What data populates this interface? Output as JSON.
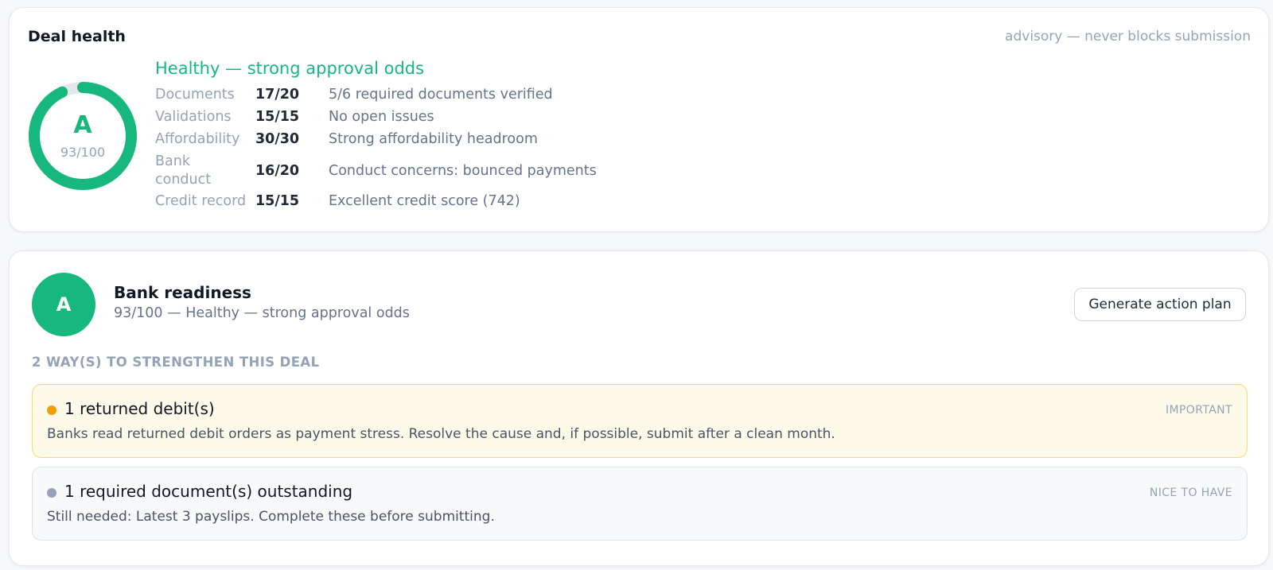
{
  "deal_health": {
    "title": "Deal health",
    "note": "advisory — never blocks submission",
    "grade": "A",
    "score_text": "93/100",
    "score": 93,
    "score_max": 100,
    "status": "Healthy — strong approval odds",
    "factors": [
      {
        "name": "Documents",
        "score": "17/20",
        "note": "5/6 required documents verified"
      },
      {
        "name": "Validations",
        "score": "15/15",
        "note": "No open issues"
      },
      {
        "name": "Affordability",
        "score": "30/30",
        "note": "Strong affordability headroom"
      },
      {
        "name": "Bank conduct",
        "score": "16/20",
        "note": "Conduct concerns: bounced payments"
      },
      {
        "name": "Credit record",
        "score": "15/15",
        "note": "Excellent credit score (742)"
      }
    ]
  },
  "bank_readiness": {
    "grade": "A",
    "title": "Bank readiness",
    "subtitle": "93/100 — Healthy — strong approval odds",
    "action_button": "Generate action plan",
    "ways_heading": "2 WAY(S) TO STRENGTHEN THIS DEAL",
    "recommendations": [
      {
        "title": "1 returned debit(s)",
        "badge": "IMPORTANT",
        "body": "Banks read returned debit orders as payment stress. Resolve the cause and, if possible, submit after a clean month."
      },
      {
        "title": "1 required document(s) outstanding",
        "badge": "NICE TO HAVE",
        "body": "Still needed: Latest 3 payslips. Complete these before submitting."
      }
    ]
  },
  "colors": {
    "accent_green": "#17b87e",
    "important_amber": "#f59e0b",
    "muted_gray": "#94a3b8"
  }
}
